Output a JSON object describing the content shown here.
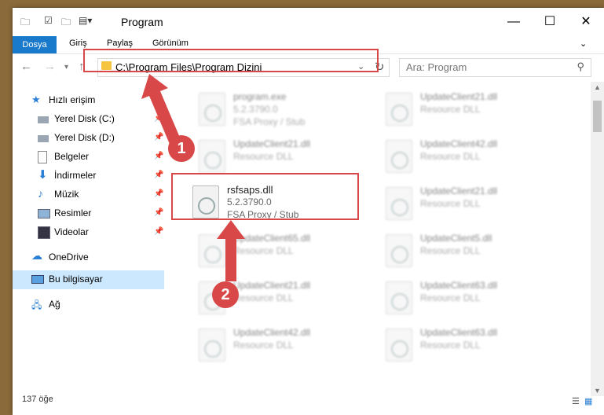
{
  "title": "Program",
  "ribbon_tabs": [
    "Dosya",
    "Giriş",
    "Paylaş",
    "Görünüm"
  ],
  "address": "C:\\Program Files\\Program Dizini",
  "search_placeholder": "Ara: Program",
  "sidebar": [
    {
      "label": "Hızlı erişim",
      "icon": "star-icon"
    },
    {
      "label": "Yerel Disk (C:)",
      "icon": "drive-icon"
    },
    {
      "label": "Yerel Disk (D:)",
      "icon": "drive-icon"
    },
    {
      "label": "Belgeler",
      "icon": "documents-icon"
    },
    {
      "label": "İndirmeler",
      "icon": "download-icon"
    },
    {
      "label": "Müzik",
      "icon": "music-icon"
    },
    {
      "label": "Resimler",
      "icon": "pictures-icon"
    },
    {
      "label": "Videolar",
      "icon": "videos-icon"
    },
    {
      "label": "OneDrive",
      "icon": "cloud-icon"
    },
    {
      "label": "Bu bilgisayar",
      "icon": "computer-icon"
    },
    {
      "label": "Ağ",
      "icon": "network-icon"
    }
  ],
  "files": [
    {
      "name": "program.exe",
      "version": "5.2.3790.0",
      "desc": "FSA Proxy / Stub"
    },
    {
      "name": "UpdateClient21.dll",
      "desc": "Resource DLL"
    },
    {
      "name": "UpdateClient21.dll",
      "desc": "Resource DLL"
    },
    {
      "name": "UpdateClient42.dll",
      "desc": "Resource DLL"
    },
    {
      "name": "rsfsaps.dll",
      "version": "5.2.3790.0",
      "desc": "FSA Proxy / Stub"
    },
    {
      "name": "UpdateClient21.dll",
      "desc": "Resource DLL"
    },
    {
      "name": "UpdateClient65.dll",
      "desc": "Resource DLL"
    },
    {
      "name": "UpdateClient5.dll",
      "desc": "Resource DLL"
    },
    {
      "name": "UpdateClient21.dll",
      "desc": "Resource DLL"
    },
    {
      "name": "UpdateClient63.dll",
      "desc": "Resource DLL"
    },
    {
      "name": "UpdateClient42.dll",
      "desc": "Resource DLL"
    },
    {
      "name": "UpdateClient63.dll",
      "desc": "Resource DLL"
    }
  ],
  "status": "137 öğe",
  "step_badges": [
    "1",
    "2"
  ]
}
